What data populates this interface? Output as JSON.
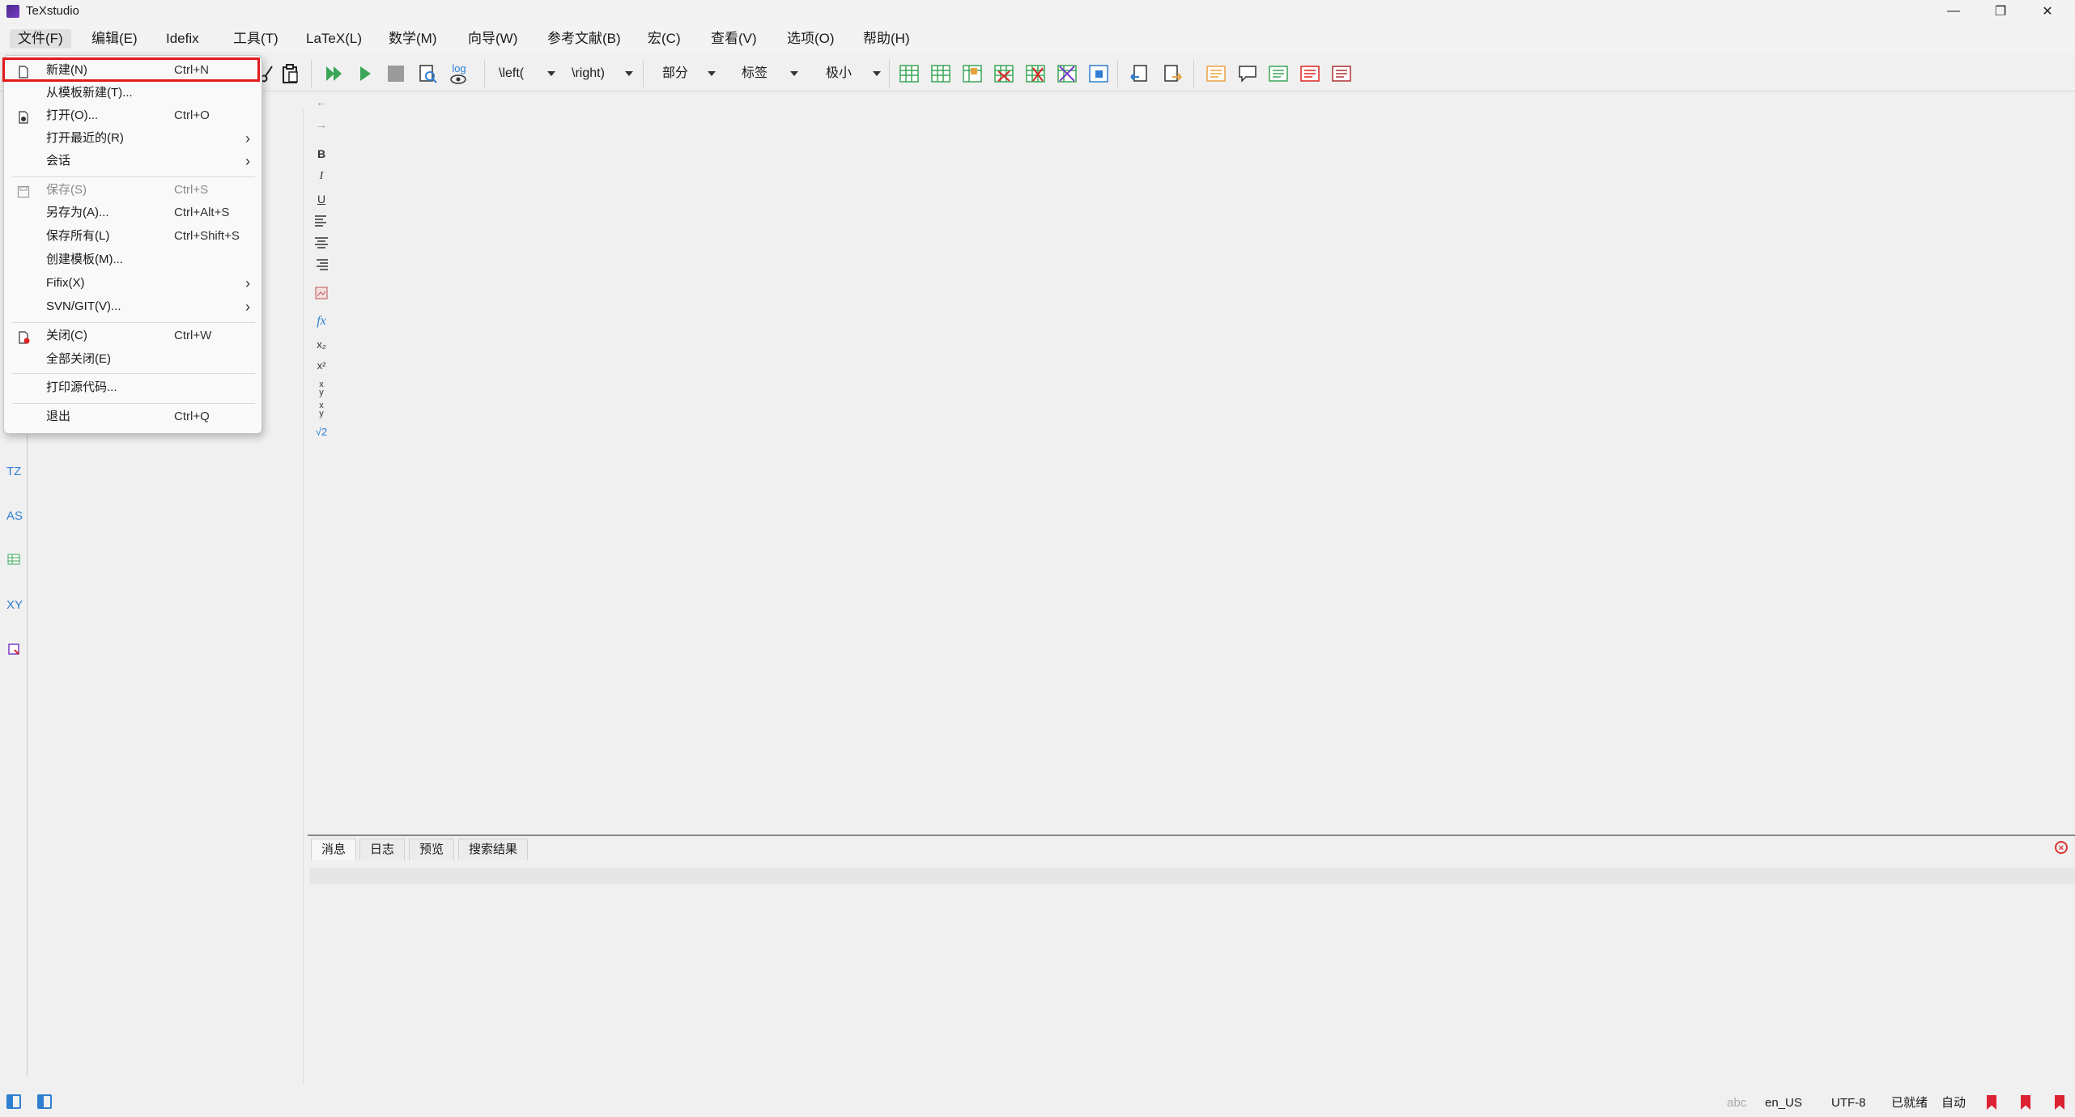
{
  "window": {
    "title": "TeXstudio"
  },
  "menubar": {
    "items": [
      "文件(F)",
      "编辑(E)",
      "Idefix",
      "工具(T)",
      "LaTeX(L)",
      "数学(M)",
      "向导(W)",
      "参考文献(B)",
      "宏(C)",
      "查看(V)",
      "选项(O)",
      "帮助(H)"
    ]
  },
  "toolbar": {
    "left_combo": "\\left(",
    "right_combo": "\\right)",
    "section_combo": "部分",
    "label_combo": "标签",
    "size_combo": "极小",
    "log_label": "log"
  },
  "file_menu": {
    "items": [
      {
        "label": "新建(N)",
        "shortcut": "Ctrl+N"
      },
      {
        "label": "从模板新建(T)...",
        "shortcut": ""
      },
      {
        "label": "打开(O)...",
        "shortcut": "Ctrl+O"
      },
      {
        "label": "打开最近的(R)",
        "shortcut": ""
      },
      {
        "label": "会话",
        "shortcut": ""
      },
      {
        "label": "保存(S)",
        "shortcut": "Ctrl+S"
      },
      {
        "label": "另存为(A)...",
        "shortcut": "Ctrl+Alt+S"
      },
      {
        "label": "保存所有(L)",
        "shortcut": "Ctrl+Shift+S"
      },
      {
        "label": "创建模板(M)...",
        "shortcut": ""
      },
      {
        "label": "Fifix(X)",
        "shortcut": ""
      },
      {
        "label": "SVN/GIT(V)...",
        "shortcut": ""
      },
      {
        "label": "关闭(C)",
        "shortcut": "Ctrl+W"
      },
      {
        "label": "全部关闭(E)",
        "shortcut": ""
      },
      {
        "label": "打印源代码...",
        "shortcut": ""
      },
      {
        "label": "退出",
        "shortcut": "Ctrl+Q"
      }
    ],
    "submenu_arrow": "›"
  },
  "sidebar": {
    "labels": [
      "TZ",
      "AS",
      "XY"
    ]
  },
  "format_toolbar": {
    "bold": "B",
    "italic": "I",
    "underline": "U",
    "fx": "fx",
    "sub": "x₂",
    "sup": "x²",
    "sqrt": "√2"
  },
  "bottom_panel": {
    "tabs": [
      "消息",
      "日志",
      "预览",
      "搜索结果"
    ]
  },
  "statusbar": {
    "language": "en_US",
    "encoding": "UTF-8",
    "status": "已就绪",
    "mode": "自动"
  },
  "colors": {
    "highlight": "#e01b1b",
    "accent_green": "#3aa657",
    "accent_blue": "#2f7fd1"
  }
}
